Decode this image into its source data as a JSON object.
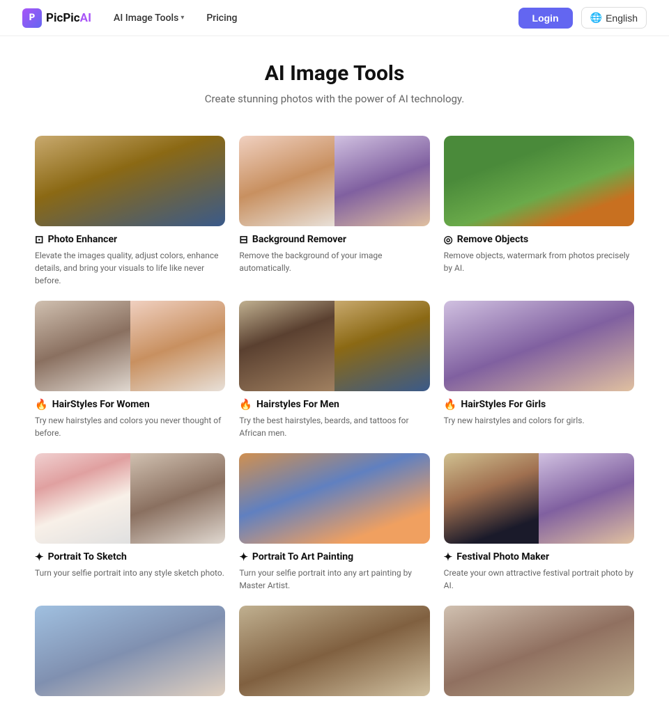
{
  "nav": {
    "logo_text": "PicPic",
    "logo_ai": "AI",
    "tools_label": "AI Image Tools",
    "pricing_label": "Pricing",
    "login_label": "Login",
    "lang_label": "English"
  },
  "hero": {
    "title": "AI Image Tools",
    "subtitle": "Create stunning photos with the power of AI technology."
  },
  "tools": [
    {
      "id": "photo-enhancer",
      "icon": "⊡",
      "title": "Photo Enhancer",
      "desc": "Elevate the images quality, adjust colors, enhance details, and bring your visuals to life like never before.",
      "img_class": "img-fox",
      "dual": false
    },
    {
      "id": "background-remover",
      "icon": "⊟",
      "title": "Background Remover",
      "desc": "Remove the background of your image automatically.",
      "img_class": "img-girl",
      "dual": true,
      "img_class2": "img-girlhair"
    },
    {
      "id": "remove-objects",
      "icon": "◎",
      "title": "Remove Objects",
      "desc": "Remove objects, watermark from photos precisely by AI.",
      "img_class": "img-dog",
      "dual": false
    },
    {
      "id": "hairstyles-women",
      "icon": "🔥",
      "title": "HairStyles For Women",
      "desc": "Try new hairstyles and colors you never thought of before.",
      "img_class": "img-woman",
      "dual": true,
      "img_class2": "img-girl"
    },
    {
      "id": "hairstyles-men",
      "icon": "🔥",
      "title": "Hairstyles For Men",
      "desc": "Try the best hairstyles, beards, and tattoos for African men.",
      "img_class": "img-man",
      "dual": true,
      "img_class2": "img-fox"
    },
    {
      "id": "hairstyles-girls",
      "icon": "🔥",
      "title": "HairStyles For Girls",
      "desc": "Try new hairstyles and colors for girls.",
      "img_class": "img-girlhair",
      "dual": false
    },
    {
      "id": "portrait-sketch",
      "icon": "✦",
      "title": "Portrait To Sketch",
      "desc": "Turn your selfie portrait into any style sketch photo.",
      "img_class": "img-sketch",
      "dual": true,
      "img_class2": "img-woman"
    },
    {
      "id": "portrait-art",
      "icon": "✦",
      "title": "Portrait To Art Painting",
      "desc": "Turn your selfie portrait into any art painting by Master Artist.",
      "img_class": "img-art",
      "dual": false
    },
    {
      "id": "festival-photo",
      "icon": "✦",
      "title": "Festival Photo Maker",
      "desc": "Create your own attractive festival portrait photo by AI.",
      "img_class": "img-festival",
      "dual": true,
      "img_class2": "img-girlhair"
    },
    {
      "id": "bottom1",
      "icon": "✦",
      "title": "",
      "desc": "",
      "img_class": "img-bottom1",
      "dual": false
    },
    {
      "id": "bottom2",
      "icon": "✦",
      "title": "",
      "desc": "",
      "img_class": "img-bottom2",
      "dual": false
    },
    {
      "id": "bottom3",
      "icon": "✦",
      "title": "",
      "desc": "",
      "img_class": "img-bottom3",
      "dual": false
    }
  ]
}
